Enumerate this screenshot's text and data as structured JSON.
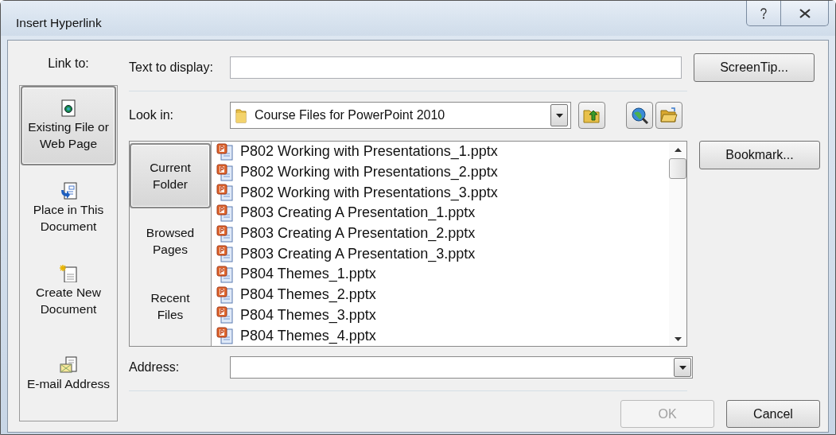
{
  "window": {
    "title": "Insert Hyperlink"
  },
  "link_to": {
    "label": "Link to:",
    "items": [
      {
        "kind": "file",
        "label": "Existing File or Web Page",
        "selected": true
      },
      {
        "kind": "place",
        "label": "Place in This Document",
        "selected": false
      },
      {
        "kind": "new",
        "label": "Create New Document",
        "selected": false
      },
      {
        "kind": "email",
        "label": "E-mail Address",
        "selected": false
      }
    ]
  },
  "text_to_display": {
    "label": "Text to display:"
  },
  "screentip_button": "ScreenTip...",
  "look_in": {
    "label": "Look in:",
    "value": "Course Files for PowerPoint 2010"
  },
  "nav": [
    {
      "label": "Current Folder",
      "selected": true
    },
    {
      "label": "Browsed Pages",
      "selected": false
    },
    {
      "label": "Recent Files",
      "selected": false
    }
  ],
  "files": [
    "P802 Working with Presentations_1.pptx",
    "P802 Working with Presentations_2.pptx",
    "P802 Working with Presentations_3.pptx",
    "P803 Creating A Presentation_1.pptx",
    "P803 Creating A Presentation_2.pptx",
    "P803 Creating A Presentation_3.pptx",
    "P804 Themes_1.pptx",
    "P804 Themes_2.pptx",
    "P804 Themes_3.pptx",
    "P804 Themes_4.pptx"
  ],
  "bookmark_button": "Bookmark...",
  "address": {
    "label": "Address:"
  },
  "buttons": [
    {
      "label": "OK",
      "disabled": true
    },
    {
      "label": "Cancel",
      "disabled": false
    }
  ]
}
